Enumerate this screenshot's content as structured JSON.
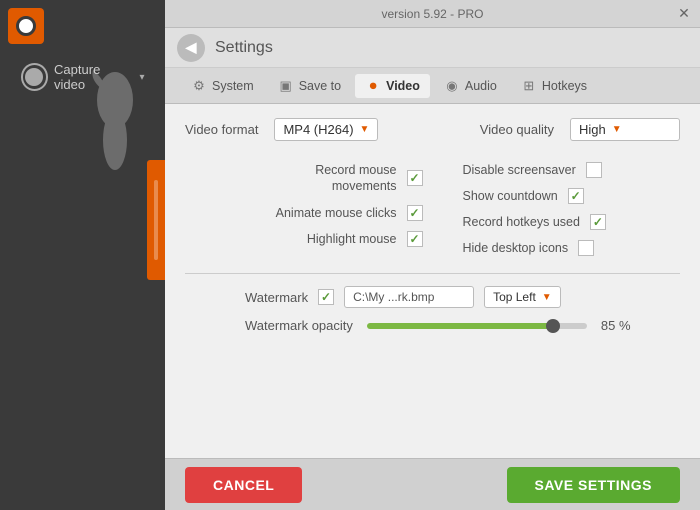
{
  "titlebar": {
    "text": "version 5.92 - PRO"
  },
  "header": {
    "back_label": "←",
    "title": "Settings"
  },
  "tabs": [
    {
      "id": "system",
      "label": "System",
      "icon": "⚙"
    },
    {
      "id": "save-to",
      "label": "Save to",
      "icon": "💾"
    },
    {
      "id": "video",
      "label": "Video",
      "icon": "⏺",
      "active": true
    },
    {
      "id": "audio",
      "label": "Audio",
      "icon": "🔊"
    },
    {
      "id": "hotkeys",
      "label": "Hotkeys",
      "icon": "⌨"
    }
  ],
  "content": {
    "video_format_label": "Video format",
    "video_format_value": "MP4 (H264)",
    "video_quality_label": "Video quality",
    "video_quality_value": "High",
    "options_left": [
      {
        "label": "Record mouse\nmovements",
        "checked": true,
        "id": "record-mouse"
      },
      {
        "label": "Animate mouse clicks",
        "checked": true,
        "id": "animate-mouse"
      },
      {
        "label": "Highlight mouse",
        "checked": true,
        "id": "highlight-mouse"
      }
    ],
    "options_right": [
      {
        "label": "Disable screensaver",
        "checked": false,
        "id": "disable-screensaver"
      },
      {
        "label": "Show countdown",
        "checked": true,
        "id": "show-countdown"
      },
      {
        "label": "Record hotkeys used",
        "checked": true,
        "id": "record-hotkeys"
      },
      {
        "label": "Hide desktop icons",
        "checked": false,
        "id": "hide-desktop"
      }
    ],
    "watermark_label": "Watermark",
    "watermark_checked": true,
    "watermark_path": "C:\\My ...rk.bmp",
    "watermark_position": "Top Left",
    "opacity_label": "Watermark opacity",
    "opacity_value": "85 %",
    "opacity_percent": 85
  },
  "buttons": {
    "cancel": "CANCEL",
    "save": "SAVE SETTINGS"
  }
}
